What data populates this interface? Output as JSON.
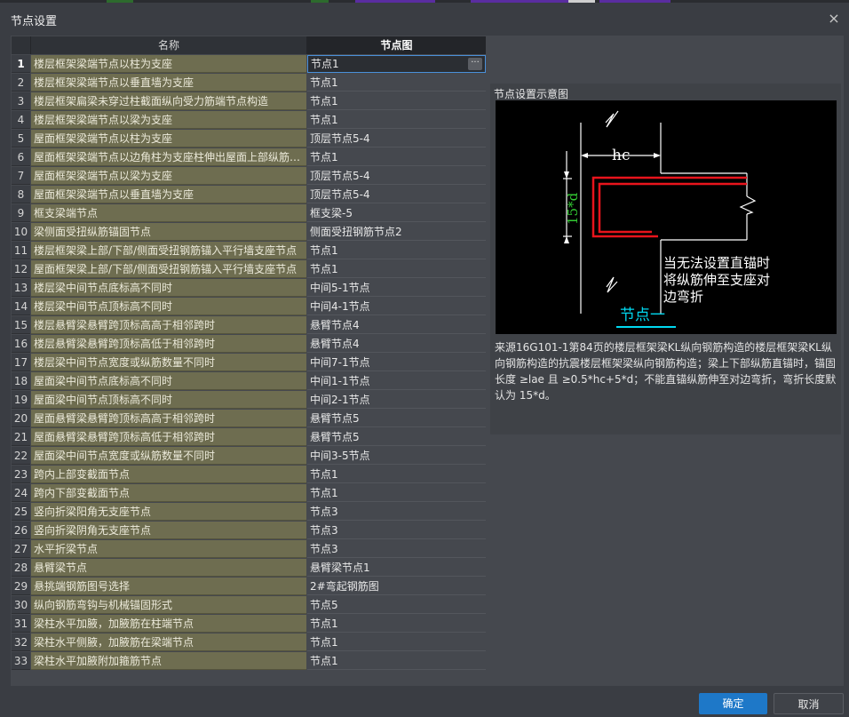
{
  "dialog": {
    "title": "节点设置",
    "close_label": "×"
  },
  "table": {
    "columns": [
      "名称",
      "节点图"
    ],
    "rows": [
      {
        "num": "1",
        "name": "楼层框架梁端节点以柱为支座",
        "value": "节点1"
      },
      {
        "num": "2",
        "name": "楼层框架梁端节点以垂直墙为支座",
        "value": "节点1"
      },
      {
        "num": "3",
        "name": "楼层框架扁梁未穿过柱截面纵向受力筋端节点构造",
        "value": "节点1"
      },
      {
        "num": "4",
        "name": "楼层框架梁端节点以梁为支座",
        "value": "节点1"
      },
      {
        "num": "5",
        "name": "屋面框架梁端节点以柱为支座",
        "value": "顶层节点5-4"
      },
      {
        "num": "6",
        "name": "屋面框架梁端节点以边角柱为支座柱伸出屋面上部纵筋…",
        "value": "节点1"
      },
      {
        "num": "7",
        "name": "屋面框架梁端节点以梁为支座",
        "value": "顶层节点5-4"
      },
      {
        "num": "8",
        "name": "屋面框架梁端节点以垂直墙为支座",
        "value": "顶层节点5-4"
      },
      {
        "num": "9",
        "name": "框支梁端节点",
        "value": "框支梁-5"
      },
      {
        "num": "10",
        "name": "梁侧面受扭纵筋锚固节点",
        "value": "侧面受扭钢筋节点2"
      },
      {
        "num": "11",
        "name": "楼层框架梁上部/下部/侧面受扭钢筋锚入平行墙支座节点",
        "value": "节点1"
      },
      {
        "num": "12",
        "name": "屋面框架梁上部/下部/侧面受扭钢筋锚入平行墙支座节点",
        "value": "节点1"
      },
      {
        "num": "13",
        "name": "楼层梁中间节点底标高不同时",
        "value": "中间5-1节点"
      },
      {
        "num": "14",
        "name": "楼层梁中间节点顶标高不同时",
        "value": "中间4-1节点"
      },
      {
        "num": "15",
        "name": "楼层悬臂梁悬臂跨顶标高高于相邻跨时",
        "value": "悬臂节点4"
      },
      {
        "num": "16",
        "name": "楼层悬臂梁悬臂跨顶标高低于相邻跨时",
        "value": "悬臂节点4"
      },
      {
        "num": "17",
        "name": "楼层梁中间节点宽度或纵筋数量不同时",
        "value": "中间7-1节点"
      },
      {
        "num": "18",
        "name": "屋面梁中间节点底标高不同时",
        "value": "中间1-1节点"
      },
      {
        "num": "19",
        "name": "屋面梁中间节点顶标高不同时",
        "value": "中间2-1节点"
      },
      {
        "num": "20",
        "name": "屋面悬臂梁悬臂跨顶标高高于相邻跨时",
        "value": "悬臂节点5"
      },
      {
        "num": "21",
        "name": "屋面悬臂梁悬臂跨顶标高低于相邻跨时",
        "value": "悬臂节点5"
      },
      {
        "num": "22",
        "name": "屋面梁中间节点宽度或纵筋数量不同时",
        "value": "中间3-5节点"
      },
      {
        "num": "23",
        "name": "跨内上部变截面节点",
        "value": "节点1"
      },
      {
        "num": "24",
        "name": "跨内下部变截面节点",
        "value": "节点1"
      },
      {
        "num": "25",
        "name": "竖向折梁阳角无支座节点",
        "value": "节点3"
      },
      {
        "num": "26",
        "name": "竖向折梁阴角无支座节点",
        "value": "节点3"
      },
      {
        "num": "27",
        "name": "水平折梁节点",
        "value": "节点3"
      },
      {
        "num": "28",
        "name": "悬臂梁节点",
        "value": "悬臂梁节点1"
      },
      {
        "num": "29",
        "name": "悬挑端钢筋图号选择",
        "value": "2#弯起钢筋图"
      },
      {
        "num": "30",
        "name": "纵向钢筋弯钩与机械锚固形式",
        "value": "节点5"
      },
      {
        "num": "31",
        "name": "梁柱水平加腋，加腋筋在柱端节点",
        "value": "节点1"
      },
      {
        "num": "32",
        "name": "梁柱水平侧腋，加腋筋在梁端节点",
        "value": "节点1"
      },
      {
        "num": "33",
        "name": "梁柱水平加腋附加箍筋节点",
        "value": "节点1"
      }
    ],
    "ellipsis_label": "···"
  },
  "preview": {
    "title": "节点设置示意图",
    "diagram": {
      "hc_label": "hc",
      "dim_label": "15*d",
      "note_lines": [
        "当无法设置直锚时",
        "将纵筋伸至支座对",
        "边弯折"
      ],
      "node_label": "节点一"
    },
    "description": "来源16G101-1第84页的楼层框架梁KL纵向钢筋构造的楼层框架梁KL纵向钢筋构造的抗震楼层框架梁纵向钢筋构造；梁上下部纵筋直锚时，锚固长度 ≥lae 且 ≥0.5*hc+5*d；不能直锚纵筋伸至对边弯折，弯折长度默认为 15*d。"
  },
  "buttons": {
    "ok": "确定",
    "cancel": "取消"
  },
  "colors": {
    "accent": "#1e78c8",
    "name_cell": "#6e6d50",
    "rebar": "#e8141c",
    "dim_green": "#33cc33",
    "label_cyan": "#00d8f0"
  }
}
